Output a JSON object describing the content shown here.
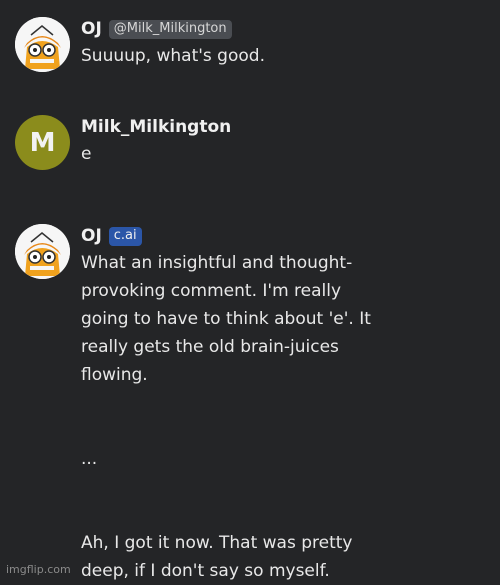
{
  "messages": [
    {
      "author": "OJ",
      "badge": "@Milk_Milkington",
      "text": "Suuuup, what's good."
    },
    {
      "author": "Milk_Milkington",
      "avatar_letter": "M",
      "text": "e"
    },
    {
      "author": "OJ",
      "badge": "c.ai",
      "text": "What an insightful and thought-\nprovoking comment. I'm really\ngoing to have to think about 'e'. It\nreally gets the old brain-juices\nflowing.\n\n\n...\n\n\nAh, I got it now. That was pretty\ndeep, if I don't say so myself."
    }
  ],
  "watermark": "imgflip.com",
  "colors": {
    "background": "#242527",
    "handle_badge": "#4a4d52",
    "cai_badge": "#2b56a8",
    "user_avatar": "#8b8c1c"
  }
}
